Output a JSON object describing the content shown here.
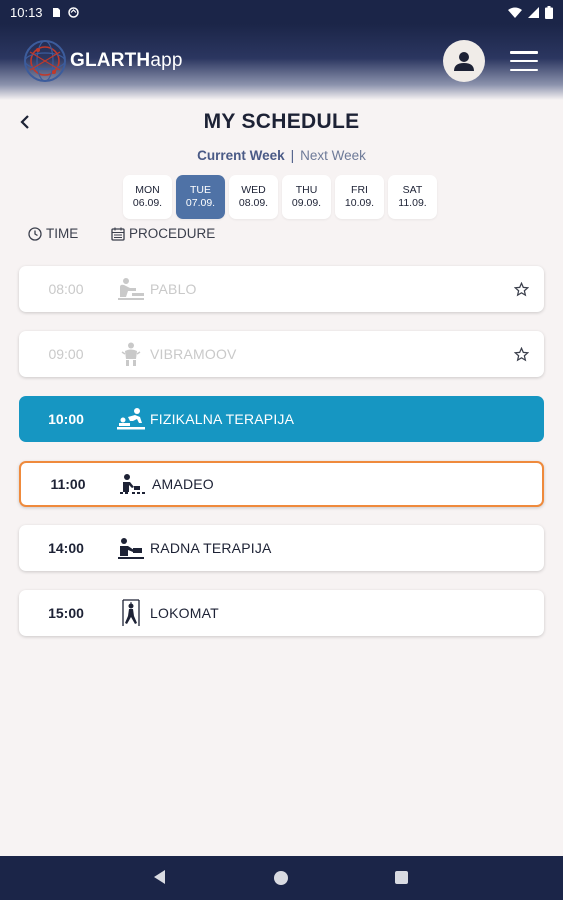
{
  "status_bar": {
    "time": "10:13"
  },
  "app": {
    "logo_bold": "GLARTH",
    "logo_light": "app"
  },
  "page": {
    "title": "MY SCHEDULE"
  },
  "week_toggle": {
    "current": "Current Week",
    "separator": "|",
    "next": "Next Week"
  },
  "days": [
    {
      "name": "MON",
      "date": "06.09.",
      "active": false
    },
    {
      "name": "TUE",
      "date": "07.09.",
      "active": true
    },
    {
      "name": "WED",
      "date": "08.09.",
      "active": false
    },
    {
      "name": "THU",
      "date": "09.09.",
      "active": false
    },
    {
      "name": "FRI",
      "date": "10.09.",
      "active": false
    },
    {
      "name": "SAT",
      "date": "11.09.",
      "active": false
    }
  ],
  "columns": {
    "time": "TIME",
    "procedure": "PROCEDURE"
  },
  "schedule": [
    {
      "time": "08:00",
      "procedure": "PABLO",
      "state": "past",
      "icon": "pablo-therapy-icon",
      "favorite": true
    },
    {
      "time": "09:00",
      "procedure": "VIBRAMOOV",
      "state": "past",
      "icon": "vibramoov-therapy-icon",
      "favorite": true
    },
    {
      "time": "10:00",
      "procedure": "FIZIKALNA TERAPIJA",
      "state": "current",
      "icon": "physical-therapy-icon",
      "favorite": false
    },
    {
      "time": "11:00",
      "procedure": "AMADEO",
      "state": "next",
      "icon": "amadeo-therapy-icon",
      "favorite": false
    },
    {
      "time": "14:00",
      "procedure": "RADNA TERAPIJA",
      "state": "upcoming",
      "icon": "occupational-therapy-icon",
      "favorite": false
    },
    {
      "time": "15:00",
      "procedure": "LOKOMAT",
      "state": "upcoming",
      "icon": "lokomat-therapy-icon",
      "favorite": false
    }
  ],
  "colors": {
    "header": "#1b2548",
    "active_day": "#4f72a6",
    "current_row": "#1696c2",
    "next_row_border": "#ef8a3c",
    "background": "#f7f3f3"
  }
}
